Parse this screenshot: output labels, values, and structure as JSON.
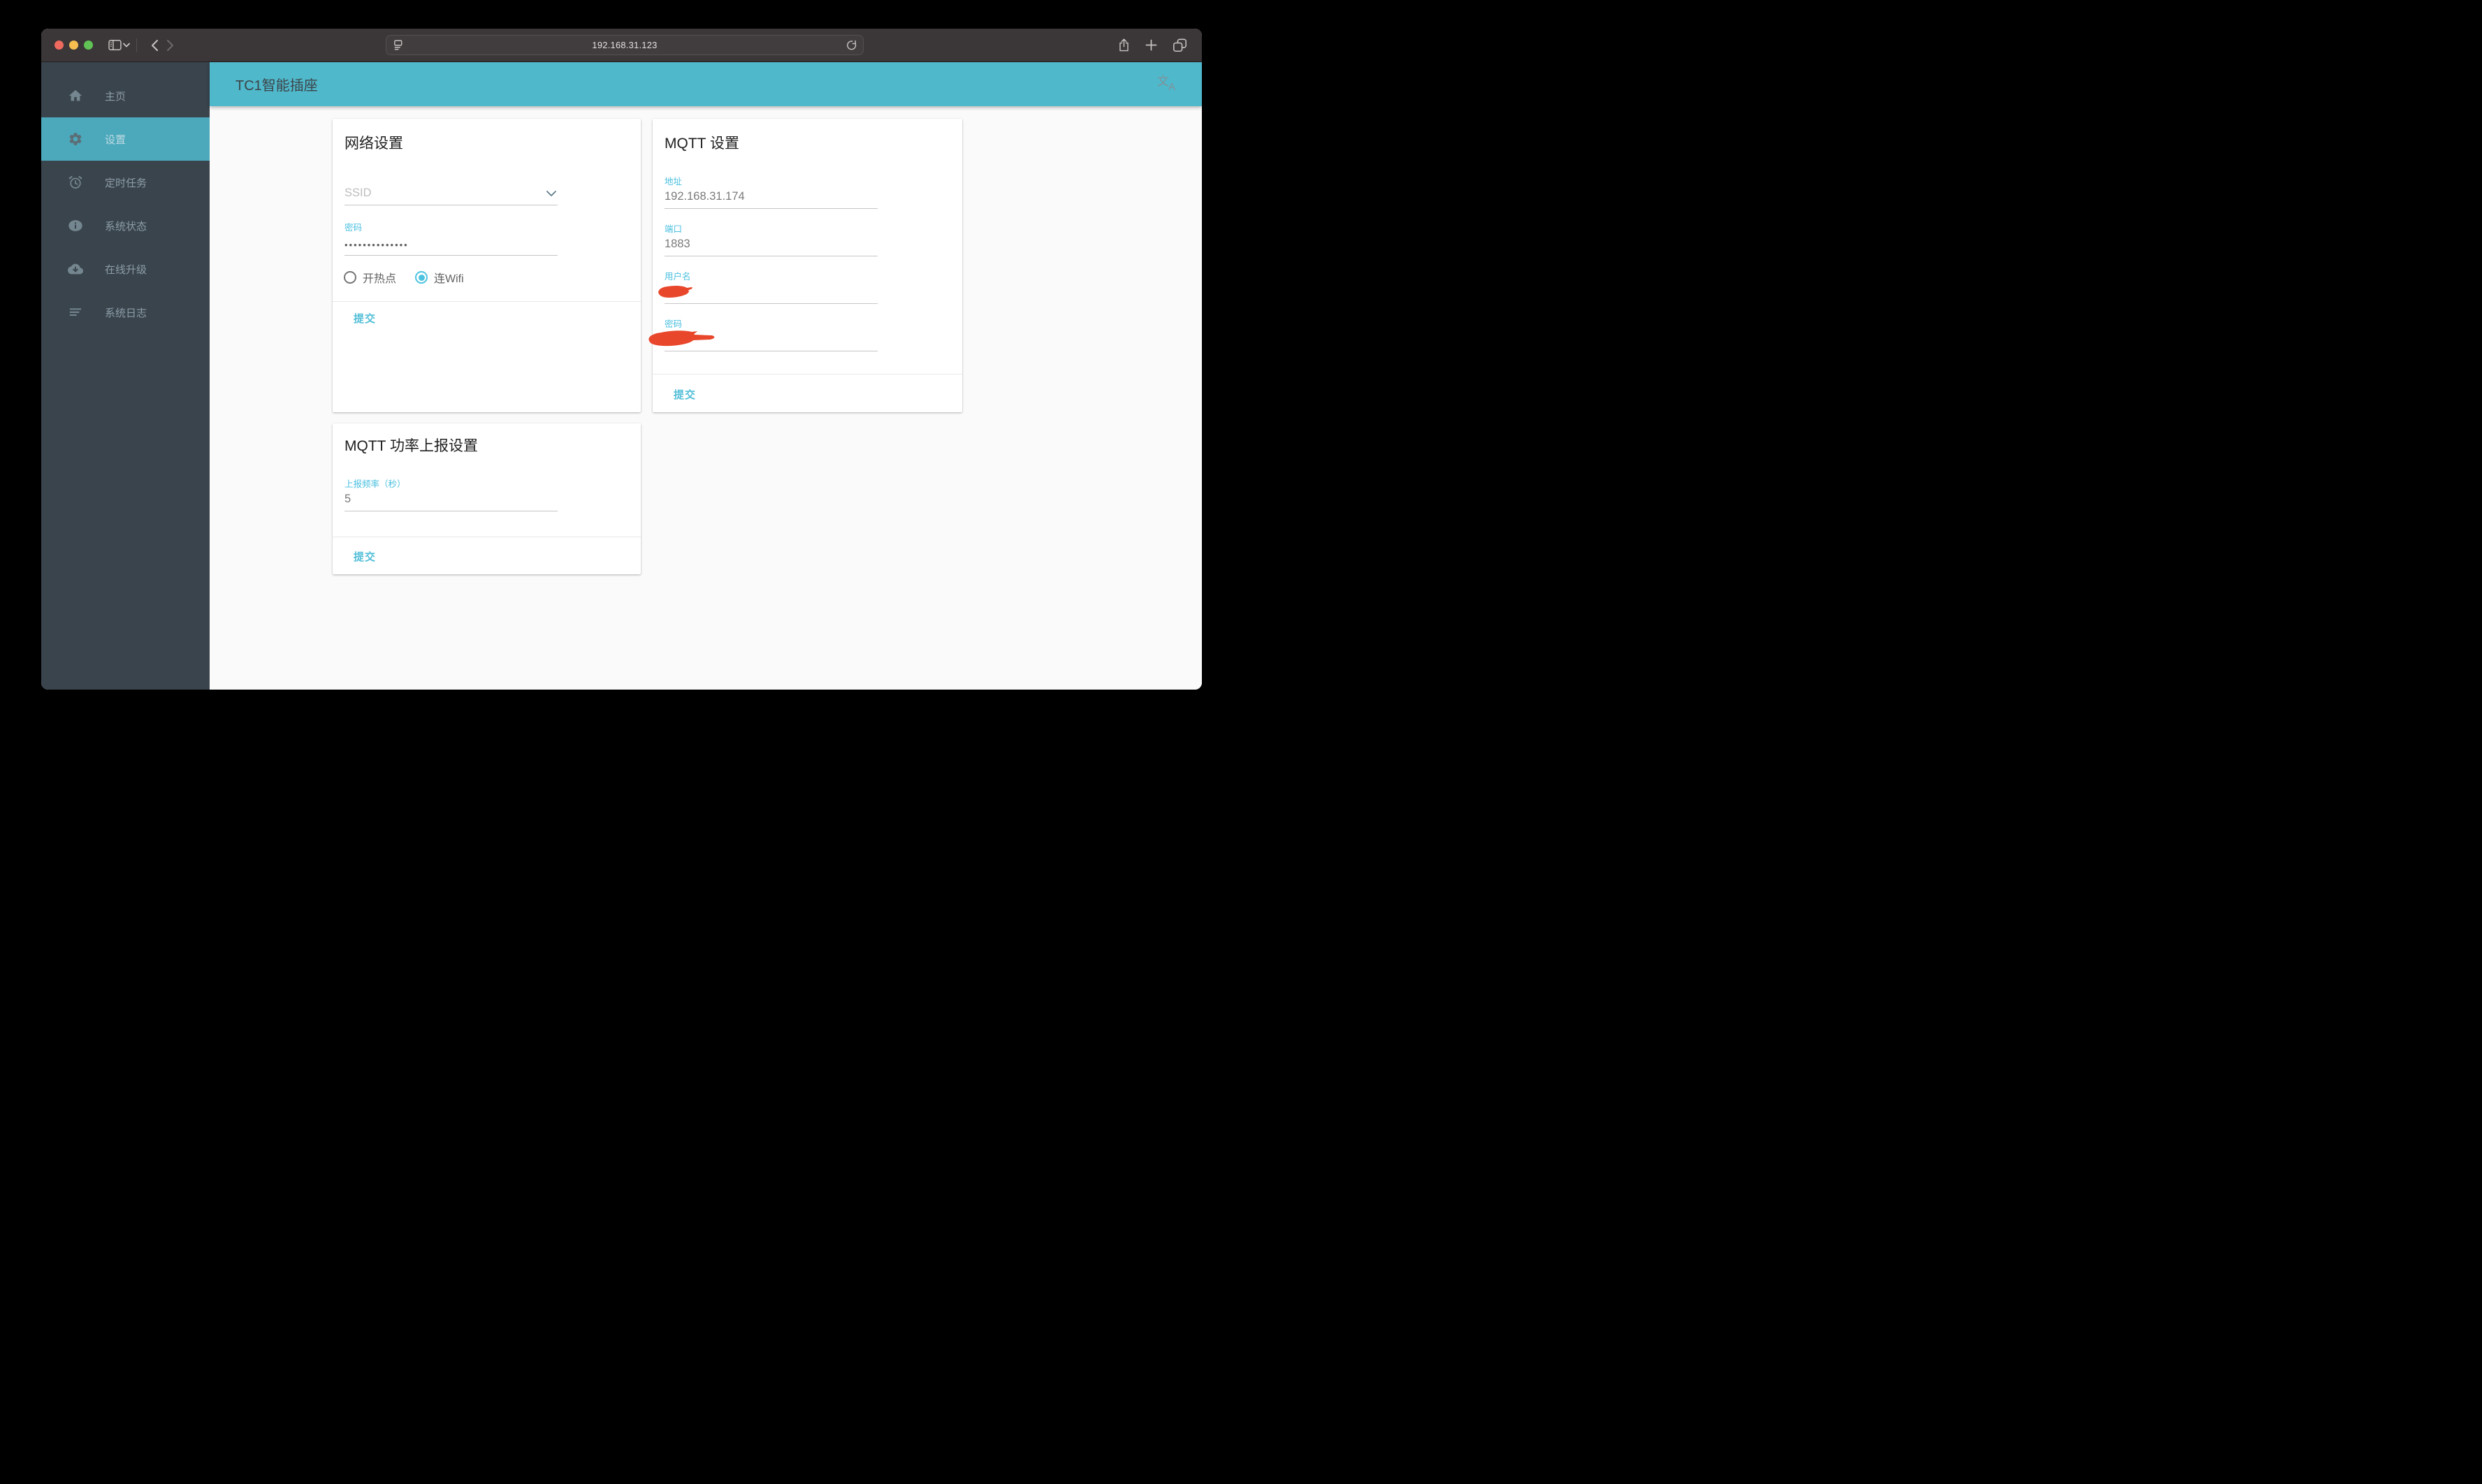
{
  "browser": {
    "url": "192.168.31.123"
  },
  "app": {
    "header": {
      "title": "TC1智能插座",
      "translate": {
        "zh": "文",
        "lat": "A"
      }
    },
    "sidebar": {
      "items": [
        {
          "label": "主页",
          "icon": "home",
          "active": false
        },
        {
          "label": "设置",
          "icon": "settings-gear",
          "active": true
        },
        {
          "label": "定时任务",
          "icon": "alarm-clock",
          "active": false
        },
        {
          "label": "系统状态",
          "icon": "info",
          "active": false
        },
        {
          "label": "在线升级",
          "icon": "cloud-download",
          "active": false
        },
        {
          "label": "系统日志",
          "icon": "log-lines",
          "active": false
        }
      ]
    },
    "cards": {
      "network": {
        "title": "网络设置",
        "ssid": {
          "placeholder": "SSID",
          "value": ""
        },
        "password": {
          "label": "密码",
          "value": "••••••••••••••"
        },
        "mode": {
          "options": [
            "开热点",
            "连Wifi"
          ],
          "selected": "连Wifi"
        },
        "submit_label": "提交"
      },
      "mqtt": {
        "title": "MQTT 设置",
        "address": {
          "label": "地址",
          "value": "192.168.31.174"
        },
        "port": {
          "label": "端口",
          "value": "1883"
        },
        "username": {
          "label": "用户名",
          "value": "",
          "redacted": true
        },
        "password": {
          "label": "密码",
          "value": "",
          "redacted": true
        },
        "submit_label": "提交"
      },
      "power": {
        "title": "MQTT 功率上报设置",
        "rate": {
          "label": "上报频率（秒）",
          "value": "5"
        },
        "submit_label": "提交"
      }
    }
  },
  "colors": {
    "header_teal": "#4FB8CB",
    "sidebar_bg": "#3A444D",
    "sidebar_active": "#4CA9BC",
    "accent_cyan": "#4BC0E0",
    "submit_cyan": "#53BFD8",
    "redaction_red": "#E8472B",
    "traffic_red": "#EE6A5F",
    "traffic_yellow": "#F5BE4F",
    "traffic_green": "#61C355"
  }
}
